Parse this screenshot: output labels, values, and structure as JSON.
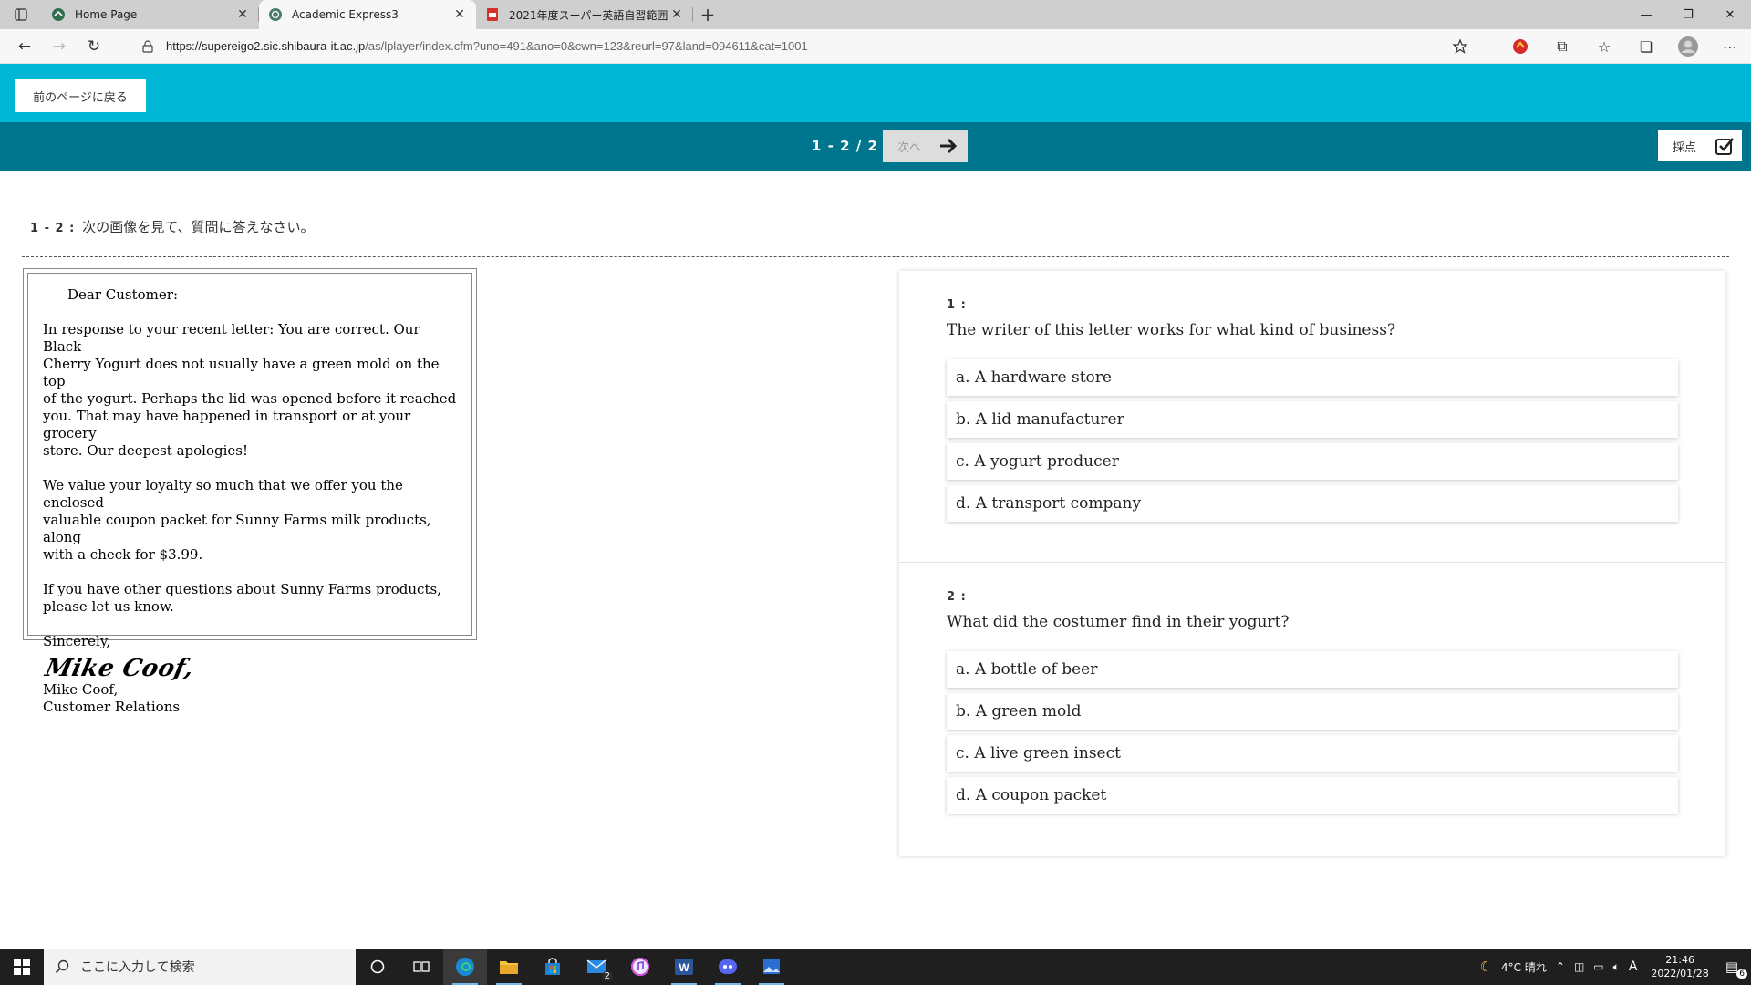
{
  "browser": {
    "tabs": [
      {
        "title": "Home Page",
        "active": false
      },
      {
        "title": "Academic Express3",
        "active": true
      },
      {
        "title": "2021年度スーパー英語自習範囲",
        "active": false
      }
    ],
    "new_tab_label": "+",
    "url_host": "https://supereigo2.sic.shibaura-it.ac.jp",
    "url_path": "/as/lplayer/index.cfm?uno=491&ano=0&cwn=123&reurl=97&land=094611&cat=1001"
  },
  "app": {
    "back_button": "前のページに戻る",
    "pager": "1 - 2 / 2",
    "next_button": "次へ",
    "grade_button": "採点",
    "accent_color": "#00b7d6",
    "bar_color": "#00768e"
  },
  "question_set": {
    "number": "1 - 2 :",
    "instruction": "次の画像を見て、質問に答えなさい。"
  },
  "letter": {
    "greeting": "Dear Customer:",
    "p1_lines": [
      "In response to your recent letter: You are correct. Our Black",
      "Cherry Yogurt does not usually have a green mold on the top",
      "of the yogurt. Perhaps the lid was opened before it reached",
      "you. That may have happened in transport or at your grocery",
      "store. Our deepest apologies!"
    ],
    "p2_lines": [
      "We value your loyalty so much that we offer you the enclosed",
      "valuable coupon packet for Sunny Farms milk products, along",
      "with a check for $3.99."
    ],
    "p3_lines": [
      "If you have other questions about Sunny Farms products,",
      "please let us know."
    ],
    "closing": "Sincerely,",
    "signature": "Mike Coof,",
    "name": "Mike Coof,",
    "title": "Customer Relations"
  },
  "questions": [
    {
      "number": "1 :",
      "text": "The writer of this letter works for what kind of business?",
      "options": [
        "a. A hardware store",
        "b. A lid manufacturer",
        "c. A yogurt producer",
        "d. A transport company"
      ]
    },
    {
      "number": "2 :",
      "text": "What did the costumer find in their yogurt?",
      "options": [
        "a. A bottle of beer",
        "b. A green mold",
        "c. A live green insect",
        "d. A coupon packet"
      ]
    }
  ],
  "taskbar": {
    "search_placeholder": "ここに入力して検索",
    "weather": "4°C 晴れ",
    "ime": "A",
    "time": "21:46",
    "date": "2022/01/28",
    "mail_badge": "2",
    "notification_count": "6"
  }
}
